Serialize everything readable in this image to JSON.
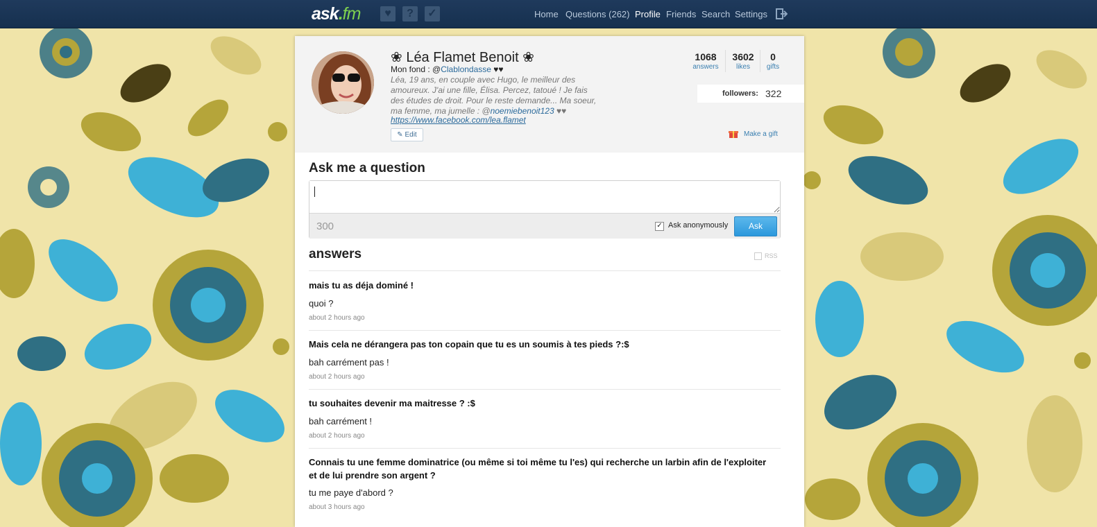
{
  "topbar": {
    "logo_main": "ask",
    "logo_dot": ".",
    "logo_suffix": "fm",
    "icons": [
      "heart-icon",
      "question-icon",
      "bird-icon"
    ],
    "nav": [
      {
        "label": "Home"
      },
      {
        "label": "Questions (262)"
      },
      {
        "label": "Profile"
      },
      {
        "label": "Friends"
      },
      {
        "label": "Search"
      },
      {
        "label": "Settings"
      }
    ],
    "logout_icon": "logout-icon"
  },
  "profile": {
    "name": "❀ Léa Flamet Benoit ❀",
    "bio_prefix": "Mon fond : @",
    "bio_link": "Clablondasse",
    "bio_suffix": " ♥♥",
    "bio_text": "Léa, 19 ans, en couple avec Hugo, le meilleur des amoureux. J'ai une fille, Élisa. Percez, tatoué ! Je fais des études de droit. Pour le reste demande... Ma soeur, ma femme, ma jumelle : @",
    "bio_mention": "noemiebenoit123",
    "bio_end": " ♥♥",
    "facebook": "https://www.facebook.com/lea.flamet",
    "edit_label": "Edit",
    "stats": [
      {
        "value": "1068",
        "label": "answers"
      },
      {
        "value": "3602",
        "label": "likes"
      },
      {
        "value": "0",
        "label": "gifts"
      }
    ],
    "followers_label": "followers:",
    "followers_value": "322",
    "gift_label": "Make a gift"
  },
  "ask": {
    "title": "Ask me a question",
    "counter": "300",
    "anonymous_label": "Ask anonymously",
    "anonymous_checked": true,
    "button_label": "Ask"
  },
  "answers": {
    "title": "answers",
    "rss_label": "RSS",
    "items": [
      {
        "question": "mais tu as déja dominé !",
        "answer": "quoi ?",
        "time": "about 2 hours ago"
      },
      {
        "question": "Mais cela ne dérangera pas ton copain que tu es un soumis à tes pieds ?:$",
        "answer": "bah carrément pas !",
        "time": "about 2 hours ago"
      },
      {
        "question": "tu souhaites devenir ma maitresse ? :$",
        "answer": "bah carrément !",
        "time": "about 2 hours ago"
      },
      {
        "question": "Connais tu une femme dominatrice (ou même si toi même tu l'es) qui recherche un larbin afin de l'exploiter et de lui prendre son argent ?",
        "answer": "tu me paye d'abord ?",
        "time": "about 3 hours ago"
      }
    ]
  },
  "colors": {
    "topbar": "#1a3556",
    "accent": "#3a7fb0",
    "background": "#f0e4a9",
    "teal": "#2f6f83",
    "olive": "#b5a53a",
    "sky": "#3eb1d6"
  }
}
